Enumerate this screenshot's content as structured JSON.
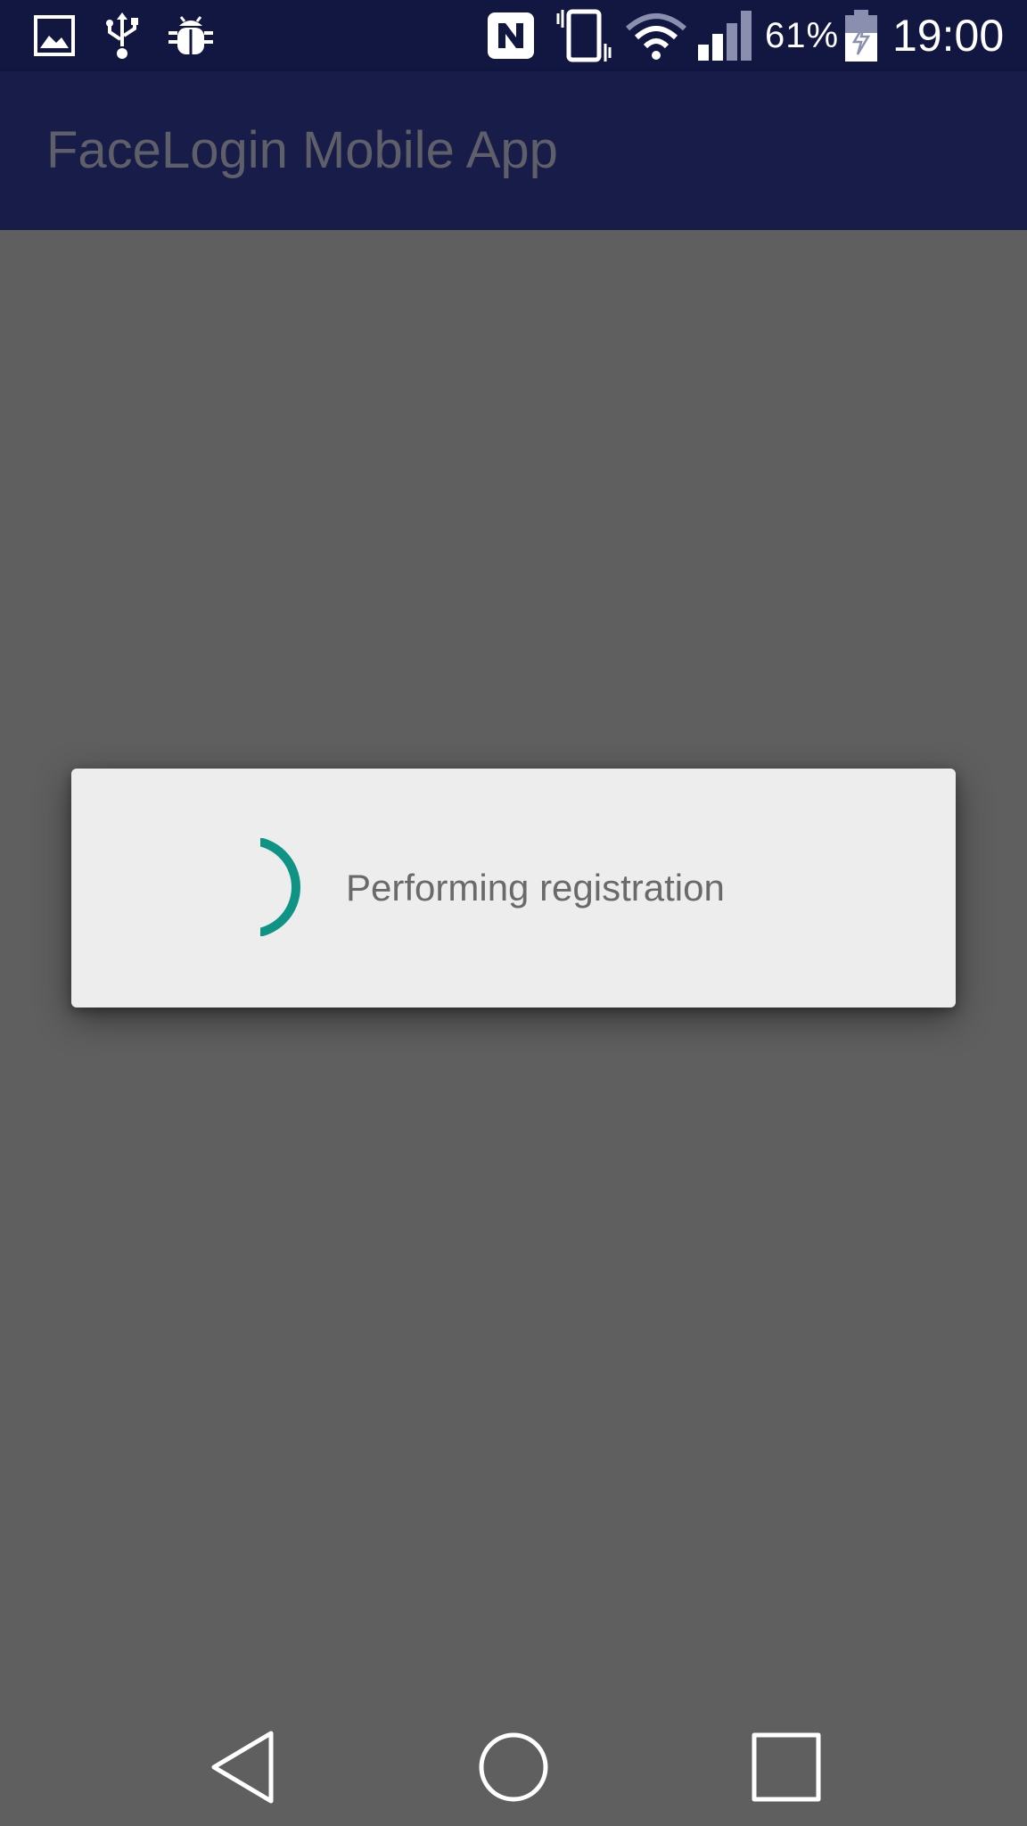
{
  "status_bar": {
    "notification_icons": [
      "image-icon",
      "usb-icon",
      "android-debug-icon"
    ],
    "system_icons": [
      "nfc-icon",
      "vibrate-icon",
      "wifi-icon",
      "signal-icon",
      "battery-charging-icon"
    ],
    "battery_percent": "61%",
    "battery_level": 0.61,
    "time": "19:00"
  },
  "app_bar": {
    "title": "FaceLogin Mobile App"
  },
  "dialog": {
    "message": "Performing registration",
    "spinner_color": "#0e9384"
  },
  "nav_bar": {
    "buttons": [
      "back-icon",
      "home-icon",
      "recents-icon"
    ]
  },
  "colors": {
    "status_bar": "#121742",
    "app_bar": "#171c49",
    "scrim": "#5f5f5f",
    "dialog_bg": "#ededed",
    "accent": "#0e9384"
  }
}
